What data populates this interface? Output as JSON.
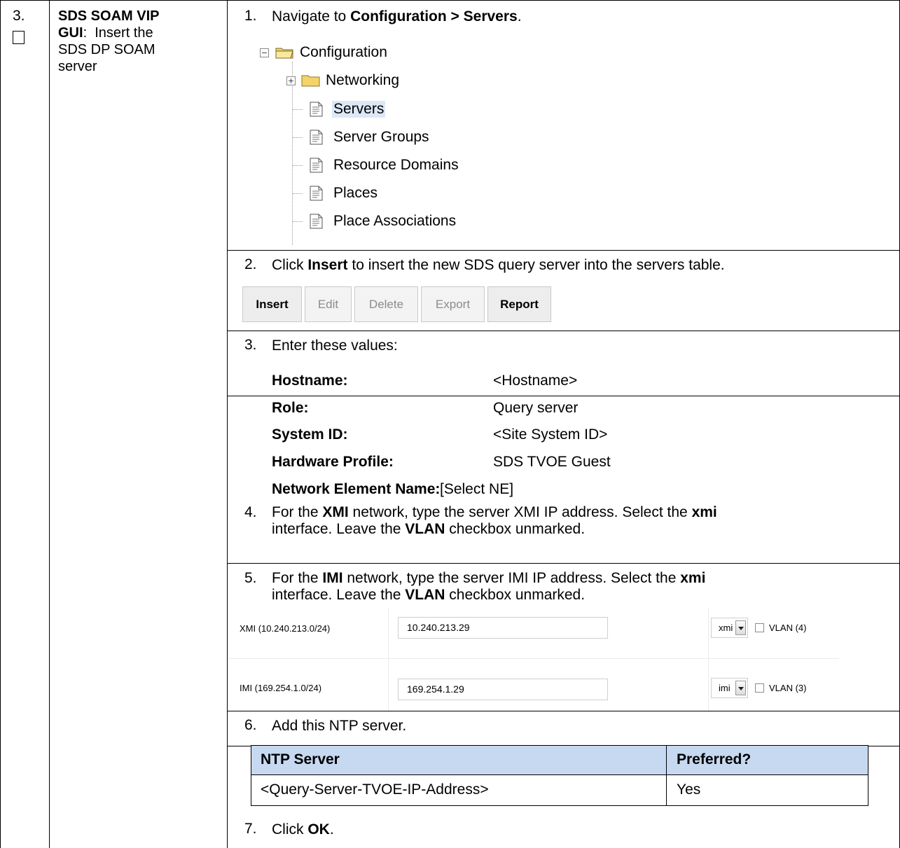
{
  "step": {
    "number": "3.",
    "title_bold": "SDS SOAM VIP GUI",
    "title_rest": ": Insert the SDS DP SOAM server",
    "title_lines": [
      "SDS SOAM VIP",
      "GUI: Insert the",
      "SDS DP SOAM",
      "server"
    ]
  },
  "substeps": {
    "s1": {
      "num": "1.",
      "pre": "Navigate to ",
      "bold": "Configuration > Servers",
      "post": "."
    },
    "s2": {
      "num": "2.",
      "pre": "Click ",
      "bold": "Insert",
      "post": " to insert the new SDS query server into the servers table."
    },
    "s3": {
      "num": "3.",
      "text": "Enter these values:"
    },
    "s4": {
      "num": "4.",
      "t1": "For the ",
      "b1": "XMI",
      "t2": " network, type the server XMI IP address.  Select the ",
      "b2": "xmi",
      "t3": "interface.  Leave the ",
      "b3": "VLAN",
      "t4": " checkbox unmarked."
    },
    "s5": {
      "num": "5.",
      "t1": "For the ",
      "b1": "IMI",
      "t2": " network, type the server IMI IP address.  Select the ",
      "b2": "xmi",
      "t3": "interface.  Leave the ",
      "b3": "VLAN",
      "t4": " checkbox unmarked."
    },
    "s6": {
      "num": "6.",
      "text": "Add this NTP server."
    },
    "s7": {
      "num": "7.",
      "pre": "Click ",
      "bold": "OK",
      "post": "."
    }
  },
  "tree": {
    "root": "Configuration",
    "items": [
      "Networking",
      "Servers",
      "Server Groups",
      "Resource Domains",
      "Places",
      "Place Associations"
    ]
  },
  "buttons": {
    "insert": "Insert",
    "edit": "Edit",
    "delete": "Delete",
    "export": "Export",
    "report": "Report"
  },
  "values": [
    {
      "label": "Hostname",
      "value": "<Hostname>"
    },
    {
      "label": "Role",
      "value": "Query server"
    },
    {
      "label": "System ID",
      "value": "<Site System ID>"
    },
    {
      "label": "Hardware Profile",
      "value": "SDS TVOE Guest"
    },
    {
      "label": "Network Element Name",
      "value": "[Select NE]"
    }
  ],
  "networks": [
    {
      "label": "XMI (10.240.213.0/24)",
      "ip": "10.240.213.29",
      "iface": "xmi",
      "vlan": "VLAN (4)"
    },
    {
      "label": "IMI (169.254.1.0/24)",
      "ip": "169.254.1.29",
      "iface": "imi",
      "vlan": "VLAN (3)"
    }
  ],
  "ntp_table": {
    "headers": [
      "NTP Server",
      "Preferred?"
    ],
    "rows": [
      [
        "<Query-Server-TVOE-IP-Address>",
        "Yes"
      ]
    ],
    "header_bg": "#c6d9f1"
  }
}
